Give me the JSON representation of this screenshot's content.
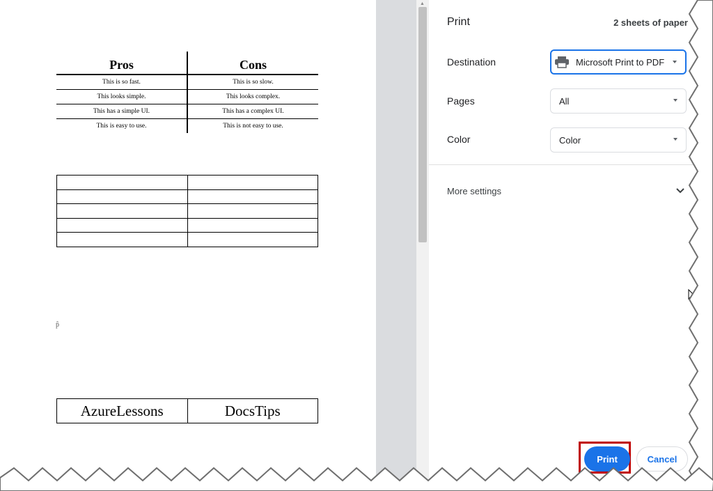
{
  "preview": {
    "pros_cons_table": {
      "headers": [
        "Pros",
        "Cons"
      ],
      "rows": [
        [
          "This is so fast.",
          "This is so slow."
        ],
        [
          "This looks simple.",
          "This looks complex."
        ],
        [
          "This has a simple UI.",
          "This has a complex UI."
        ],
        [
          "This is easy to use.",
          "This is not easy to use."
        ]
      ]
    },
    "paragraph_mark": "p̂",
    "links_table": [
      "AzureLessons",
      "DocsTips"
    ]
  },
  "sidebar": {
    "title": "Print",
    "sheets": "2 sheets of paper",
    "destination": {
      "label": "Destination",
      "value": "Microsoft Print to PDF",
      "icon": "printer-icon"
    },
    "pages": {
      "label": "Pages",
      "value": "All"
    },
    "color": {
      "label": "Color",
      "value": "Color"
    },
    "more_settings": "More settings",
    "print_button": "Print",
    "cancel_button": "Cancel"
  },
  "colors": {
    "accent": "#1a73e8",
    "highlight": "#c00000",
    "gutter": "#dadcdf"
  }
}
